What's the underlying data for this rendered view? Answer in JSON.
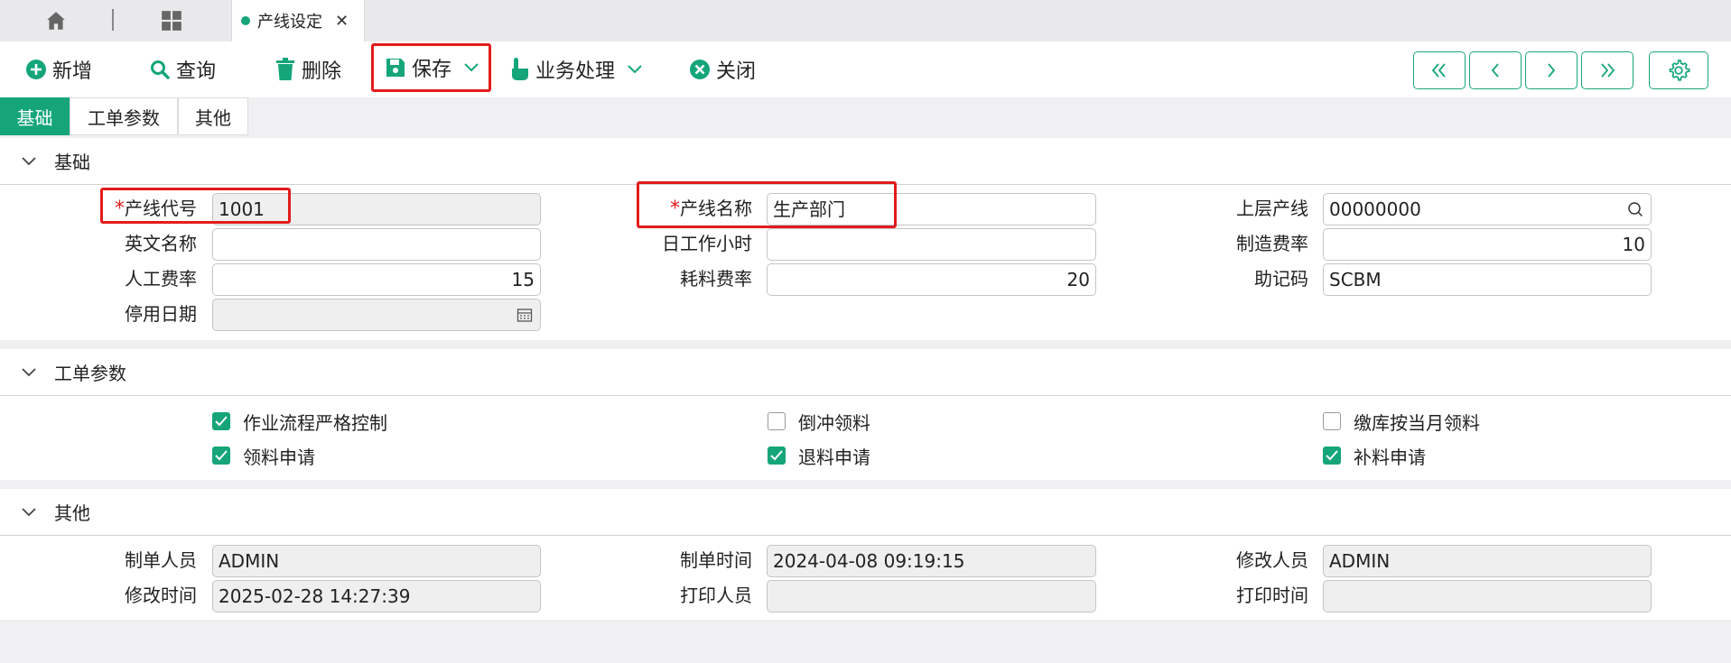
{
  "tabbar": {
    "home_icon": "home-icon",
    "grid_icon": "apps-grid-icon",
    "doc_tab_label": "产线设定",
    "close_glyph": "✕"
  },
  "toolbar": {
    "add": "新增",
    "query": "查询",
    "delete": "删除",
    "save": "保存",
    "business": "业务处理",
    "close": "关闭"
  },
  "section_tabs": [
    "基础",
    "工单参数",
    "其他"
  ],
  "sections": {
    "basic": "基础",
    "workorder": "工单参数",
    "other": "其他"
  },
  "basic": {
    "line_code_label": "产线代号",
    "line_code": "1001",
    "line_name_label": "产线名称",
    "line_name": "生产部门",
    "parent_line_label": "上层产线",
    "parent_line": "00000000",
    "english_name_label": "英文名称",
    "english_name": "",
    "daily_hours_label": "日工作小时",
    "daily_hours": "",
    "mfg_rate_label": "制造费率",
    "mfg_rate": "10",
    "labor_rate_label": "人工费率",
    "labor_rate": "15",
    "material_rate_label": "耗料费率",
    "material_rate": "20",
    "mnemonic_label": "助记码",
    "mnemonic": "SCBM",
    "disable_date_label": "停用日期",
    "disable_date": ""
  },
  "workorder": {
    "strict_flow": {
      "label": "作业流程严格控制",
      "checked": true
    },
    "backflush": {
      "label": "倒冲领料",
      "checked": false
    },
    "monthly_pick": {
      "label": "缴库按当月领料",
      "checked": false
    },
    "pick_request": {
      "label": "领料申请",
      "checked": true
    },
    "return_request": {
      "label": "退料申请",
      "checked": true
    },
    "supplement_request": {
      "label": "补料申请",
      "checked": true
    }
  },
  "other": {
    "creator_label": "制单人员",
    "creator": "ADMIN",
    "created_time_label": "制单时间",
    "created_time": "2024-04-08 09:19:15",
    "modifier_label": "修改人员",
    "modifier": "ADMIN",
    "modified_time_label": "修改时间",
    "modified_time": "2025-02-28 14:27:39",
    "printer_label": "打印人员",
    "printer": "",
    "print_time_label": "打印时间",
    "print_time": ""
  },
  "colors": {
    "accent": "#15a579",
    "highlight": "#e11c1c"
  }
}
